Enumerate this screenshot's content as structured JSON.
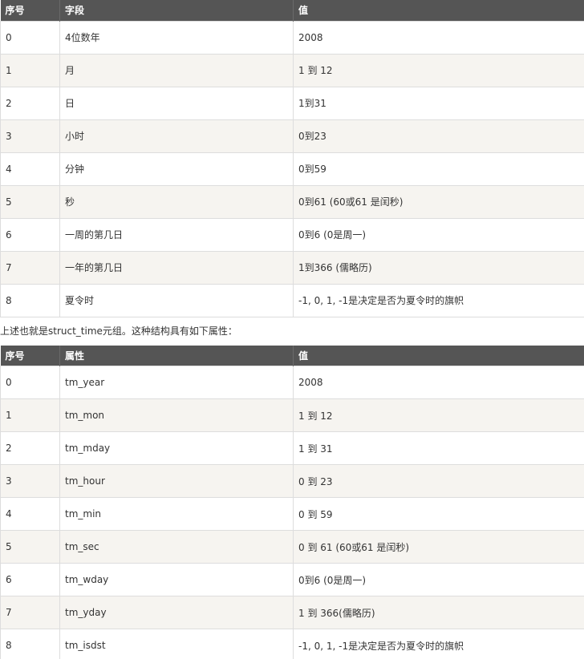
{
  "table1": {
    "headers": [
      "序号",
      "字段",
      "值"
    ],
    "rows": [
      [
        "0",
        "4位数年",
        "2008"
      ],
      [
        "1",
        "月",
        "1 到 12"
      ],
      [
        "2",
        "日",
        "1到31"
      ],
      [
        "3",
        "小时",
        "0到23"
      ],
      [
        "4",
        "分钟",
        "0到59"
      ],
      [
        "5",
        "秒",
        "0到61 (60或61 是闰秒)"
      ],
      [
        "6",
        "一周的第几日",
        "0到6 (0是周一)"
      ],
      [
        "7",
        "一年的第几日",
        "1到366 (儒略历)"
      ],
      [
        "8",
        "夏令时",
        "-1, 0, 1, -1是决定是否为夏令时的旗帜"
      ]
    ]
  },
  "caption": "上述也就是struct_time元组。这种结构具有如下属性：",
  "table2": {
    "headers": [
      "序号",
      "属性",
      "值"
    ],
    "rows": [
      [
        "0",
        "tm_year",
        "2008"
      ],
      [
        "1",
        "tm_mon",
        "1 到 12"
      ],
      [
        "2",
        "tm_mday",
        "1 到 31"
      ],
      [
        "3",
        "tm_hour",
        "0 到 23"
      ],
      [
        "4",
        "tm_min",
        "0 到 59"
      ],
      [
        "5",
        "tm_sec",
        "0 到 61 (60或61 是闰秒)"
      ],
      [
        "6",
        "tm_wday",
        "0到6 (0是周一)"
      ],
      [
        "7",
        "tm_yday",
        "1 到 366(儒略历)"
      ],
      [
        "8",
        "tm_isdst",
        "-1, 0, 1, -1是决定是否为夏令时的旗帜"
      ]
    ]
  }
}
